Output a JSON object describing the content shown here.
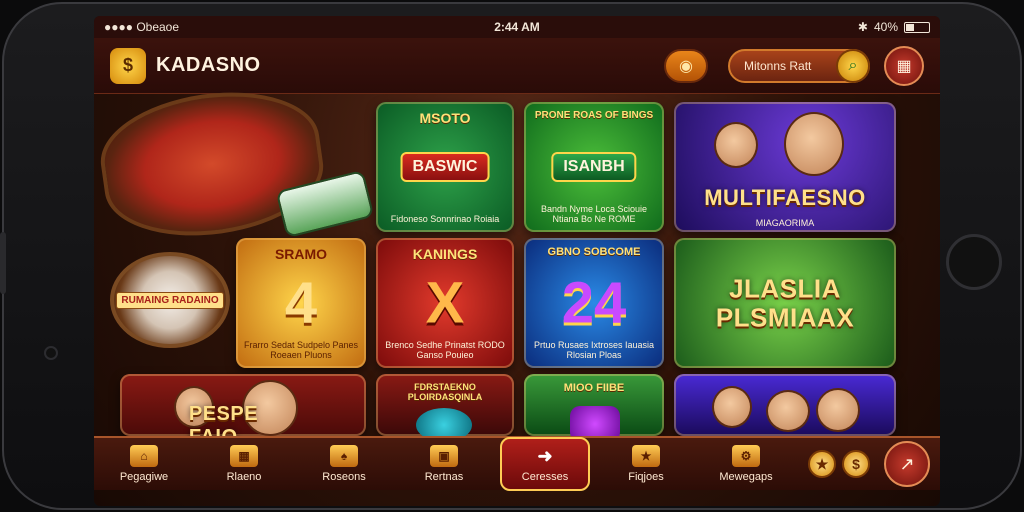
{
  "status_bar": {
    "left": "●●●● Obeaoe",
    "time": "2:44 AM",
    "battery_percent": "40%",
    "battery_level": 0.4
  },
  "header": {
    "brand": "KADASNO",
    "search_placeholder": "Mitonns Ratt",
    "coin_icon": "coin-icon",
    "menu_icon": "menu-icon"
  },
  "scene": {
    "wheel_label": "RUMAING RADAINO"
  },
  "tiles": [
    {
      "title": "MSOTO",
      "banner": "BASWIC",
      "sub": "Fidoneso Sonnrinao Roiaia",
      "icon": "coin-emblem"
    },
    {
      "title": "PRONE ROAS OF BINGS",
      "banner": "ISANBH",
      "sub": "Bandn Nyme Loca Sciouie Ntiana Bo Ne ROME",
      "icon": "coin-emblem"
    },
    {
      "title": "MULTIFAESNO",
      "sub": "MIAGAORIMA",
      "icon": "characters"
    },
    {
      "title": "SRAMO",
      "glyph": "4",
      "sub": "Frarro Sedat Sudpelo Panes Roeaen Pluons",
      "icon": "number-4"
    },
    {
      "title": "KANINGS",
      "glyph": "X",
      "sub": "Brenco Sedhe Prinatst RODO Ganso Pouieo",
      "icon": "letter-x"
    },
    {
      "title": "GBNO SOBCOME",
      "glyph": "24",
      "sub": "Prtuo Rusaes Ixtroses Iauasia Rlosian Ploas",
      "icon": "number-24"
    },
    {
      "title": "JLASLIA PLSMIAAX",
      "icon": "title-art"
    },
    {
      "title": "FDRSTAEKNO PLOIRDASQINLA",
      "icon": "fruit-slot"
    },
    {
      "title": "MIOO FIIBE",
      "icon": "purple-slot"
    },
    {
      "title": "PESPE FAIO",
      "icon": "poster"
    },
    {
      "title": "",
      "icon": "faces"
    }
  ],
  "bottom_nav": [
    {
      "label": "Pegagiwe",
      "icon": "home-icon"
    },
    {
      "label": "Rlaeno",
      "icon": "grid-icon"
    },
    {
      "label": "Roseons",
      "icon": "cards-icon"
    },
    {
      "label": "Rertnas",
      "icon": "box-icon"
    },
    {
      "label": "Ceresses",
      "icon": "play-icon",
      "active": true
    },
    {
      "label": "Fiqjoes",
      "icon": "star-icon"
    },
    {
      "label": "Mewegaps",
      "icon": "gear-icon"
    }
  ],
  "bottom_coins": [
    "★",
    "$"
  ],
  "bottom_action_icon": "arrow-icon",
  "colors": {
    "accent": "#ffcc55",
    "bg": "#2c1208",
    "active": "#b01f1a"
  }
}
